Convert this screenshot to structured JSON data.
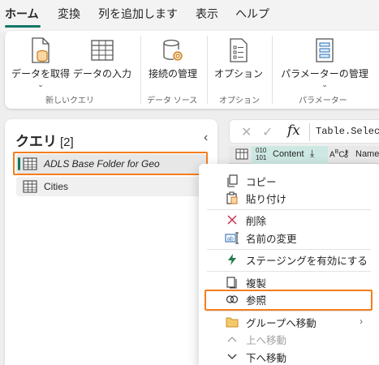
{
  "tabs": [
    {
      "label": "ホーム",
      "active": true
    },
    {
      "label": "変換"
    },
    {
      "label": "列を追加します"
    },
    {
      "label": "表示"
    },
    {
      "label": "ヘルプ"
    }
  ],
  "ribbon": {
    "buttons": {
      "get_data": "データを取得",
      "enter_data": "データの入力",
      "manage_connections": "接続の管理",
      "options": "オプション",
      "manage_parameters": "パラメーターの管理"
    },
    "groups": {
      "new_query": "新しいクエリ",
      "data_sources": "データ ソース",
      "options": "オプション",
      "parameters": "パラメーター"
    }
  },
  "queries": {
    "title": "クエリ",
    "count": "[2]",
    "items": [
      {
        "name": "ADLS Base Folder for Geo",
        "selected": true
      },
      {
        "name": "Cities",
        "selected": false
      }
    ]
  },
  "formula": {
    "text": "Table.Select"
  },
  "grid": {
    "col_type": "010\n101",
    "col_content": "Content",
    "col_name": "Name"
  },
  "context_menu": {
    "items": [
      {
        "label": "コピー",
        "icon": "copy-icon"
      },
      {
        "label": "貼り付け",
        "icon": "paste-icon"
      },
      {
        "label": "削除",
        "icon": "delete-icon"
      },
      {
        "label": "名前の変更",
        "icon": "rename-icon"
      },
      {
        "label": "ステージングを有効にする",
        "icon": "lightning-icon"
      },
      {
        "label": "複製",
        "icon": "duplicate-icon"
      },
      {
        "label": "参照",
        "icon": "reference-icon",
        "highlighted": true
      },
      {
        "label": "グループへ移動",
        "icon": "folder-icon"
      },
      {
        "label": "上へ移動",
        "icon": "chevron-up-icon",
        "disabled": true
      },
      {
        "label": "下へ移動",
        "icon": "chevron-down-icon"
      }
    ]
  },
  "colors": {
    "accent": "#117865",
    "highlight": "#f57d1c",
    "delete": "#c4314b",
    "folder": "#e8b34a"
  }
}
